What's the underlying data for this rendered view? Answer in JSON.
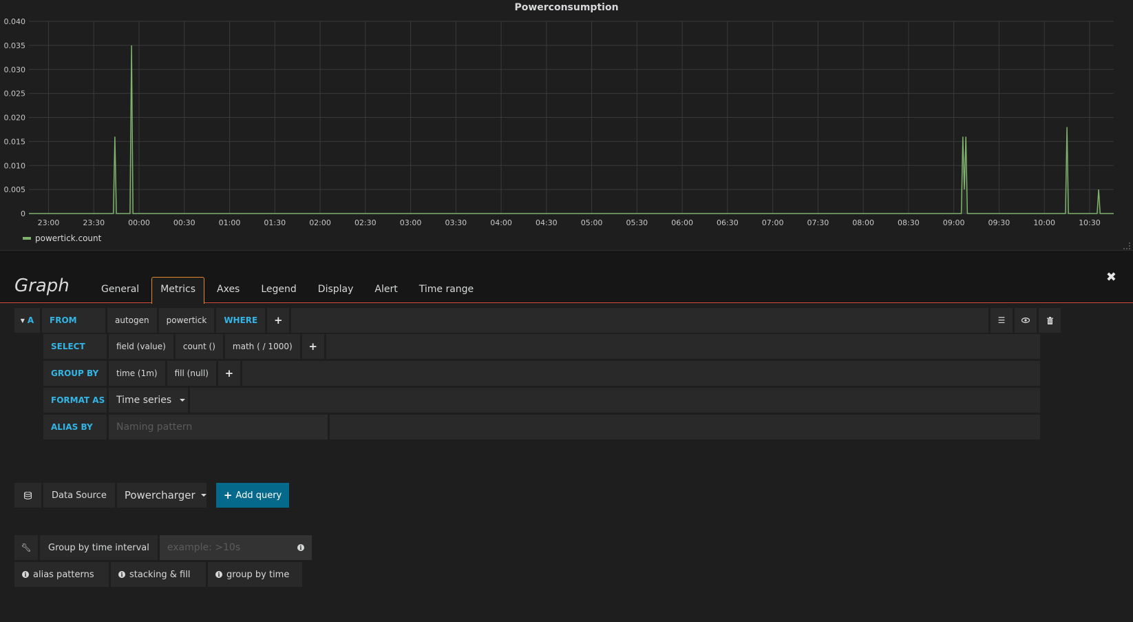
{
  "panel": {
    "title": "Powerconsumption",
    "legend": [
      {
        "label": "powertick.count",
        "color": "#7eb26d"
      }
    ]
  },
  "chart_data": {
    "type": "line",
    "title": "Powerconsumption",
    "xlabel": "",
    "ylabel": "",
    "x_unit": "time (HH:MM)",
    "xlim": [
      "22:47",
      "10:46"
    ],
    "ylim": [
      0,
      0.04
    ],
    "grid": true,
    "legend_position": "bottom-left",
    "y_ticks": [
      "0",
      "0.005",
      "0.010",
      "0.015",
      "0.020",
      "0.025",
      "0.030",
      "0.035",
      "0.040"
    ],
    "y_tick_values": [
      0,
      0.005,
      0.01,
      0.015,
      0.02,
      0.025,
      0.03,
      0.035,
      0.04
    ],
    "x_ticks": [
      "23:00",
      "23:30",
      "00:00",
      "00:30",
      "01:00",
      "01:30",
      "02:00",
      "02:30",
      "03:00",
      "03:30",
      "04:00",
      "04:30",
      "05:00",
      "05:30",
      "06:00",
      "06:30",
      "07:00",
      "07:30",
      "08:00",
      "08:30",
      "09:00",
      "09:30",
      "10:00",
      "10:30"
    ],
    "series": [
      {
        "name": "powertick.count",
        "color": "#7eb26d",
        "points": [
          [
            "22:47",
            0
          ],
          [
            "23:43",
            0
          ],
          [
            "23:44",
            0.016
          ],
          [
            "23:45",
            0
          ],
          [
            "23:54",
            0
          ],
          [
            "23:55",
            0.035
          ],
          [
            "23:56",
            0
          ],
          [
            "09:05",
            0
          ],
          [
            "09:06",
            0.016
          ],
          [
            "09:07",
            0.005
          ],
          [
            "09:08",
            0.016
          ],
          [
            "09:09",
            0
          ],
          [
            "10:14",
            0
          ],
          [
            "10:15",
            0.018
          ],
          [
            "10:16",
            0
          ],
          [
            "10:35",
            0
          ],
          [
            "10:36",
            0.005
          ],
          [
            "10:37",
            0
          ],
          [
            "10:46",
            0
          ]
        ]
      }
    ]
  },
  "editor": {
    "title": "Graph",
    "tabs": [
      "General",
      "Metrics",
      "Axes",
      "Legend",
      "Display",
      "Alert",
      "Time range"
    ],
    "active_tab": "Metrics",
    "close_label": "✖"
  },
  "query": {
    "ref_id": "A",
    "from": {
      "label": "FROM",
      "policy": "autogen",
      "measurement": "powertick",
      "where_label": "WHERE",
      "add": "+"
    },
    "select": {
      "label": "SELECT",
      "parts": [
        "field (value)",
        "count ()",
        "math ( / 1000)"
      ],
      "add": "+"
    },
    "group_by": {
      "label": "GROUP BY",
      "parts": [
        "time (1m)",
        "fill (null)"
      ],
      "add": "+"
    },
    "format_as": {
      "label": "FORMAT AS",
      "value": "Time series"
    },
    "alias_by": {
      "label": "ALIAS BY",
      "placeholder": "Naming pattern",
      "value": ""
    }
  },
  "footer": {
    "data_source_label": "Data Source",
    "data_source_value": "Powercharger",
    "add_query_label": "Add query",
    "group_interval_label": "Group by time interval",
    "group_interval_placeholder": "example: >10s",
    "help": [
      "alias patterns",
      "stacking & fill",
      "group by time"
    ]
  }
}
